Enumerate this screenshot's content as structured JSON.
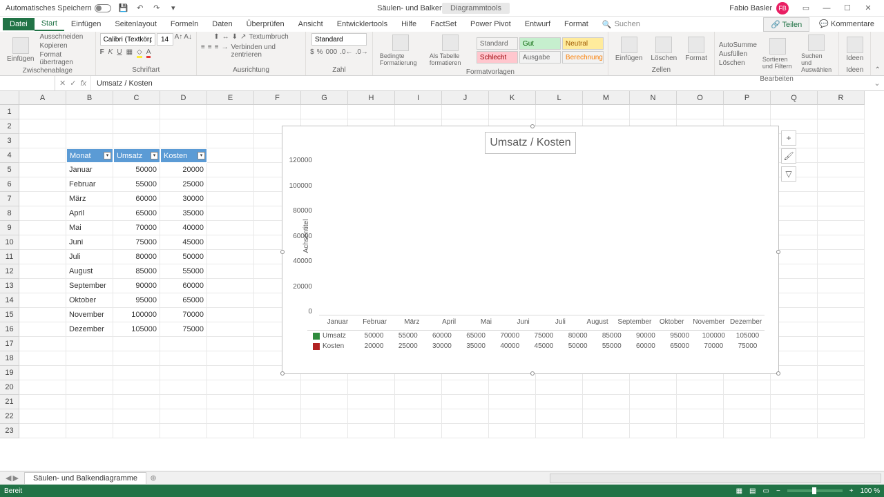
{
  "titlebar": {
    "auto_save": "Automatisches Speichern",
    "doc_title": "Säulen- und Balkendiagramme - Excel",
    "chart_tools": "Diagrammtools",
    "user_name": "Fabio Basler",
    "user_initials": "FB"
  },
  "ribbon_tabs": {
    "file": "Datei",
    "tabs": [
      "Start",
      "Einfügen",
      "Seitenlayout",
      "Formeln",
      "Daten",
      "Überprüfen",
      "Ansicht",
      "Entwicklertools",
      "Hilfe",
      "FactSet",
      "Power Pivot",
      "Entwurf",
      "Format"
    ],
    "search": "Suchen",
    "teilen": "Teilen",
    "kommentare": "Kommentare"
  },
  "ribbon": {
    "clipboard": {
      "einfugen": "Einfügen",
      "cut": "Ausschneiden",
      "copy": "Kopieren",
      "format": "Format übertragen",
      "label": "Zwischenablage"
    },
    "font": {
      "name": "Calibri (Textkörpe",
      "size": "14",
      "label": "Schriftart"
    },
    "alignment": {
      "wrap": "Textumbruch",
      "merge": "Verbinden und zentrieren",
      "label": "Ausrichtung"
    },
    "number": {
      "format": "Standard",
      "label": "Zahl"
    },
    "styles": {
      "bedingte": "Bedingte Formatierung",
      "als_tabelle": "Als Tabelle formatieren",
      "cells": [
        "Standard",
        "Gut",
        "Neutral",
        "Schlecht",
        "Ausgabe",
        "Berechnung"
      ],
      "label": "Formatvorlagen"
    },
    "cells_group": {
      "einfugen": "Einfügen",
      "loschen": "Löschen",
      "format": "Format",
      "label": "Zellen"
    },
    "editing": {
      "sum": "AutoSumme",
      "fill": "Ausfüllen",
      "clear": "Löschen",
      "sort": "Sortieren und Filtern",
      "find": "Suchen und Auswählen",
      "label": "Bearbeiten"
    },
    "ideen": {
      "ideen": "Ideen",
      "label": "Ideen"
    }
  },
  "formula_bar": {
    "name_box": "",
    "formula": "Umsatz / Kosten"
  },
  "columns": [
    "A",
    "B",
    "C",
    "D",
    "E",
    "F",
    "G",
    "H",
    "I",
    "J",
    "K",
    "L",
    "M",
    "N",
    "O",
    "P",
    "Q",
    "R"
  ],
  "table": {
    "headers": [
      "Monat",
      "Umsatz",
      "Kosten"
    ],
    "rows": [
      [
        "Januar",
        "50000",
        "20000"
      ],
      [
        "Februar",
        "55000",
        "25000"
      ],
      [
        "März",
        "60000",
        "30000"
      ],
      [
        "April",
        "65000",
        "35000"
      ],
      [
        "Mai",
        "70000",
        "40000"
      ],
      [
        "Juni",
        "75000",
        "45000"
      ],
      [
        "Juli",
        "80000",
        "50000"
      ],
      [
        "August",
        "85000",
        "55000"
      ],
      [
        "September",
        "90000",
        "60000"
      ],
      [
        "Oktober",
        "95000",
        "65000"
      ],
      [
        "November",
        "100000",
        "70000"
      ],
      [
        "Dezember",
        "105000",
        "75000"
      ]
    ]
  },
  "chart_data": {
    "type": "bar",
    "title": "Umsatz / Kosten",
    "ylabel": "Achsentitel",
    "ylim": [
      0,
      120000
    ],
    "yticks": [
      "120000",
      "100000",
      "80000",
      "60000",
      "40000",
      "20000",
      "0"
    ],
    "categories": [
      "Januar",
      "Februar",
      "März",
      "April",
      "Mai",
      "Juni",
      "Juli",
      "August",
      "September",
      "Oktober",
      "November",
      "Dezember"
    ],
    "series": [
      {
        "name": "Umsatz",
        "values": [
          50000,
          55000,
          60000,
          65000,
          70000,
          75000,
          80000,
          85000,
          90000,
          95000,
          100000,
          105000
        ]
      },
      {
        "name": "Kosten",
        "values": [
          20000,
          25000,
          30000,
          35000,
          40000,
          45000,
          50000,
          55000,
          60000,
          65000,
          70000,
          75000
        ]
      }
    ]
  },
  "sheet": {
    "name": "Säulen- und Balkendiagramme"
  },
  "status": {
    "ready": "Bereit",
    "zoom": "100 %"
  }
}
